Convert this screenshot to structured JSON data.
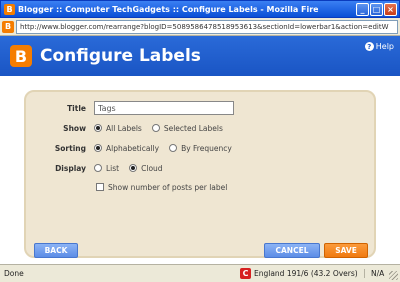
{
  "window": {
    "title": "Blogger :: Computer TechGadgets :: Configure Labels - Mozilla Firefox",
    "minimize": "_",
    "maximize": "□",
    "close": "×"
  },
  "address_bar": {
    "url": "http://www.blogger.com/rearrange?blogID=5089586478518953613&sectionId=lowerbar1&action=editW"
  },
  "header": {
    "logo_letter": "B",
    "title": "Configure Labels",
    "help_label": "Help",
    "help_icon_glyph": "?"
  },
  "form": {
    "title_label": "Title",
    "title_value": "Tags",
    "show_label": "Show",
    "show_options": [
      "All Labels",
      "Selected Labels"
    ],
    "show_selected": "All Labels",
    "sorting_label": "Sorting",
    "sorting_options": [
      "Alphabetically",
      "By Frequency"
    ],
    "sorting_selected": "Alphabetically",
    "display_label": "Display",
    "display_options": [
      "List",
      "Cloud"
    ],
    "display_selected": "Cloud",
    "show_count_label": "Show number of posts per label",
    "show_count_checked": false
  },
  "buttons": {
    "back": "BACK",
    "cancel": "CANCEL",
    "save": "SAVE"
  },
  "status_bar": {
    "status": "Done",
    "score_icon_glyph": "C",
    "score": "England 191/6 (43.2 Overs)",
    "na": "N/A"
  },
  "colors": {
    "header_blue": "#1a55c4",
    "panel_bg": "#efe6d2",
    "save_orange": "#f07a10",
    "button_blue": "#5c8de6"
  }
}
